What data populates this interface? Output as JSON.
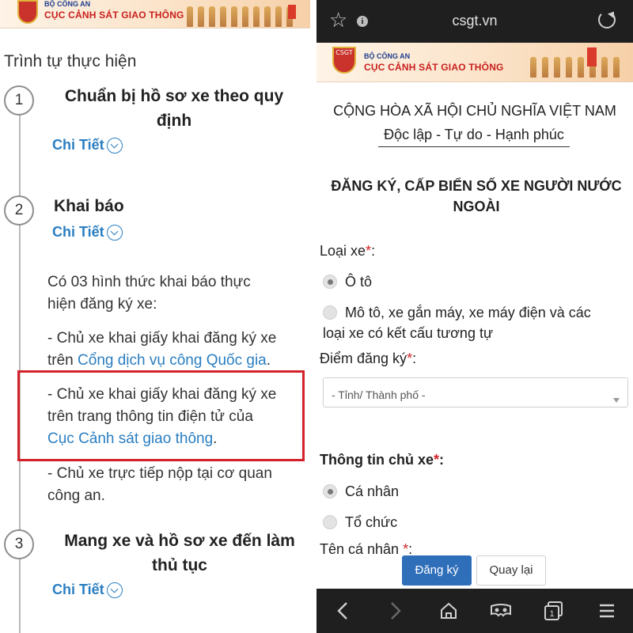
{
  "left": {
    "banner": {
      "small": "BỘ CÔNG AN",
      "big": "CỤC CẢNH SÁT GIAO THÔNG"
    },
    "heading": "Trình tự thực hiện",
    "steps": [
      {
        "num": "1",
        "title_line1": "Chuẩn bị hồ sơ xe theo quy",
        "title_line2": "định",
        "detail": "Chi Tiết"
      },
      {
        "num": "2",
        "title_line1": "Khai báo",
        "detail": "Chi Tiết"
      },
      {
        "num": "3",
        "title_line1": "Mang xe và hồ sơ xe đến làm",
        "title_line2": "thủ tục",
        "detail": "Chi Tiết"
      }
    ],
    "paragraphs": {
      "intro_line1": "Có 03 hình thức khai báo thực",
      "intro_line2": "hiện đăng ký xe:",
      "opt1_line1": "- Chủ xe khai giấy khai đăng ký xe",
      "opt1_pre": "trên ",
      "opt1_link": "Cổng dịch vụ công Quốc gia",
      "opt1_post": ".",
      "opt2_line1": "- Chủ xe khai giấy khai đăng ký xe",
      "opt2_line2": "trên trang thông tin điện tử của",
      "opt2_link": "Cục Cảnh sát giao thông",
      "opt2_post": ".",
      "opt3_line1": "- Chủ xe trực tiếp nộp tại cơ quan",
      "opt3_line2": "công an."
    }
  },
  "right": {
    "browser": {
      "url": "csgt.vn"
    },
    "banner": {
      "small": "BỘ CÔNG AN",
      "big": "CỤC CẢNH SÁT GIAO THÔNG",
      "emblem_text": "CSGT"
    },
    "nation": "CỘNG HÒA XÃ HỘI CHỦ NGHĨA VIỆT NAM",
    "motto": "Độc lập - Tự do - Hạnh phúc",
    "form_title_line1": "ĐĂNG KÝ, CẤP BIỂN SỐ XE NGƯỜI NƯỚC",
    "form_title_line2": "NGOÀI",
    "vehicle_type": {
      "label": "Loại xe",
      "required": "*",
      "colon": ":",
      "options": [
        {
          "label": "Ô tô",
          "selected": true
        },
        {
          "label_line1": "Mô tô, xe gắn máy, xe máy điện và các",
          "label_line2": "loại xe có kết cấu tương tự",
          "selected": false
        }
      ]
    },
    "registration_point": {
      "label": "Điểm đăng ký",
      "required": "*",
      "colon": ":",
      "placeholder": "- Tỉnh/ Thành phố -"
    },
    "owner_info": {
      "label": "Thông tin chủ xe",
      "required": "*",
      "colon": ":",
      "options": [
        {
          "label": "Cá nhân",
          "selected": true
        },
        {
          "label": "Tổ chức",
          "selected": false
        }
      ]
    },
    "person_name": {
      "label": "Tên cá nhân ",
      "required": "*",
      "colon": ":"
    },
    "buttons": {
      "submit": "Đăng ký",
      "back": "Quay lại"
    },
    "bottom_nav": [
      "back-icon",
      "forward-icon",
      "home-icon",
      "reading-mode-icon",
      "tabs-icon",
      "menu-icon"
    ],
    "tabs_count": "1"
  },
  "colors": {
    "link": "#2a7ec1",
    "highlight": "#d3222a",
    "primary_button": "#2f6fba",
    "browser_bar": "#1f1f1f"
  }
}
